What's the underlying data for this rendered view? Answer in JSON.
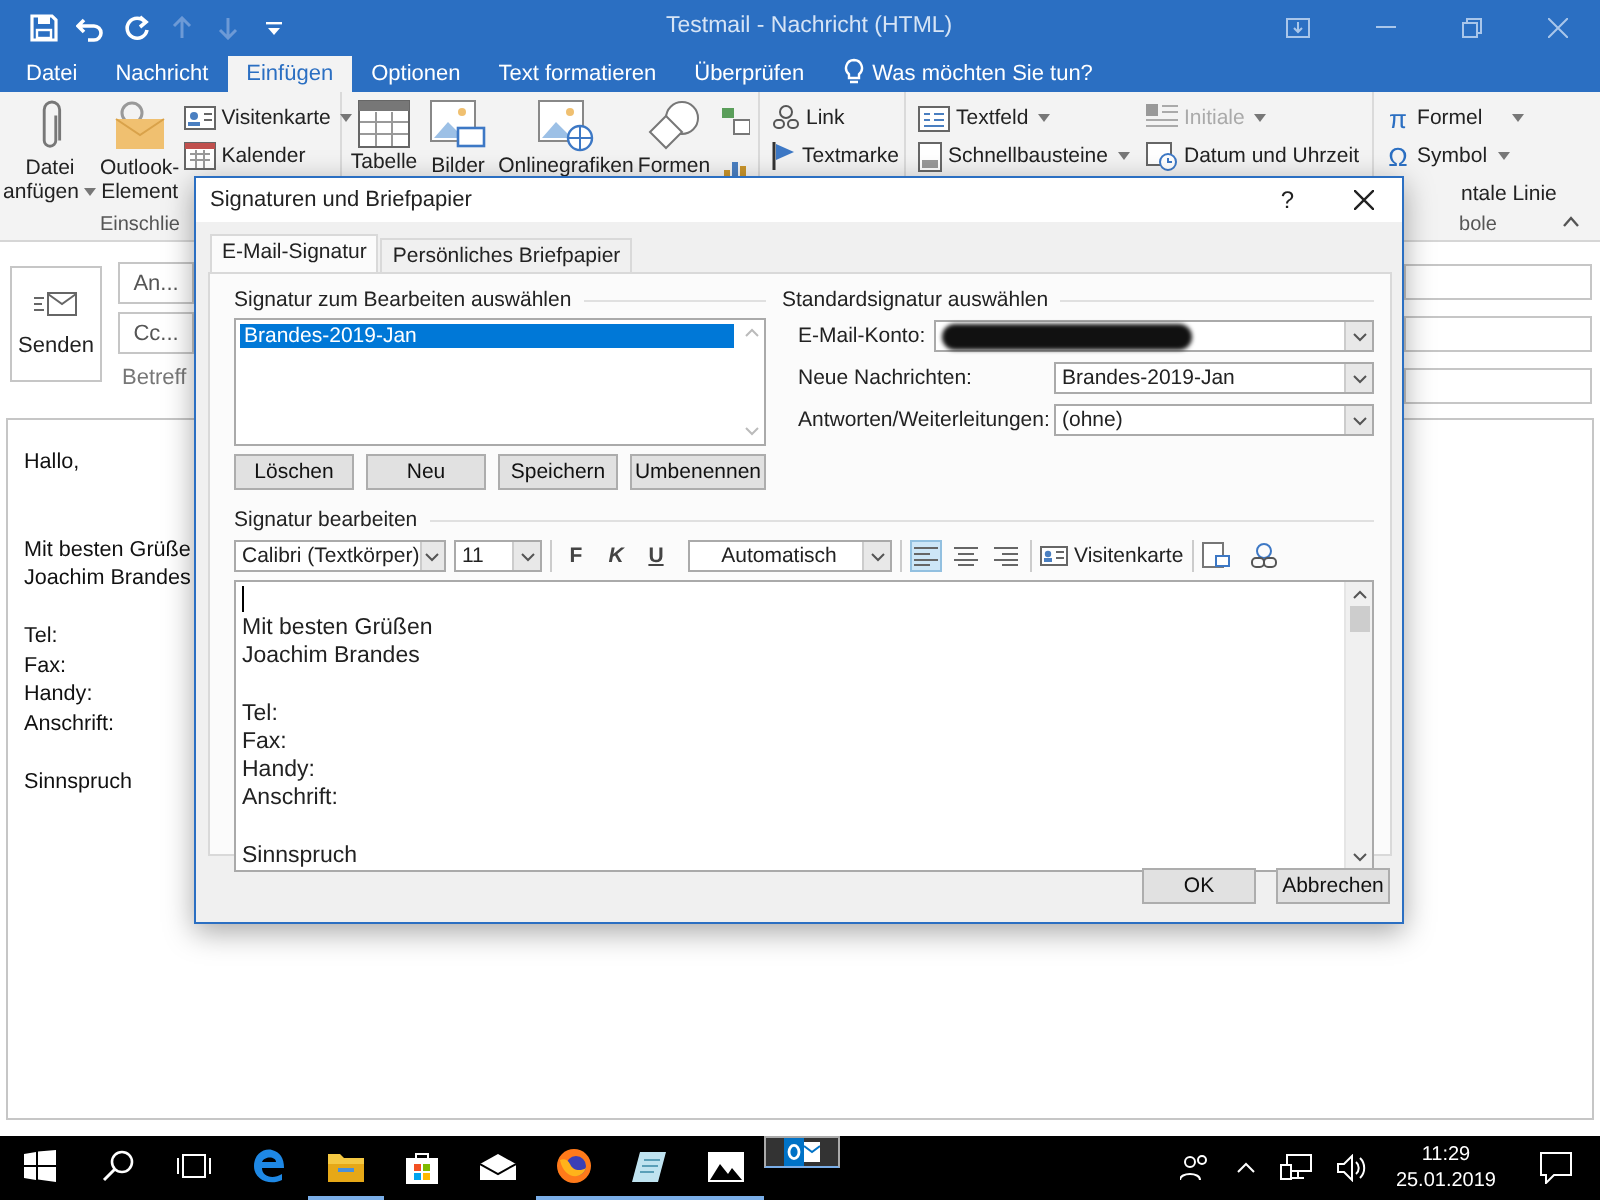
{
  "window": {
    "title": "Testmail - Nachricht (HTML)"
  },
  "quick_access": [
    {
      "kind": "save",
      "disabled": false
    },
    {
      "kind": "undo",
      "disabled": false
    },
    {
      "kind": "redo",
      "disabled": false
    },
    {
      "kind": "up",
      "disabled": true
    },
    {
      "kind": "down",
      "disabled": true
    },
    {
      "kind": "customize",
      "disabled": false
    }
  ],
  "ribbon_tabs": [
    {
      "label": "Datei",
      "selected": false
    },
    {
      "label": "Nachricht",
      "selected": false
    },
    {
      "label": "Einfügen",
      "selected": true
    },
    {
      "label": "Optionen",
      "selected": false
    },
    {
      "label": "Text formatieren",
      "selected": false
    },
    {
      "label": "Überprüfen",
      "selected": false
    }
  ],
  "tell_me": "Was möchten Sie tun?",
  "ribbon": {
    "attach_file": {
      "lines": [
        "Datei",
        "anfügen"
      ],
      "dropdown": true
    },
    "outlook_item": {
      "lines": [
        "Outlook-",
        "Element"
      ],
      "dropdown": false
    },
    "business_card": {
      "label": "Visitenkarte",
      "dropdown": true
    },
    "calendar": {
      "label": "Kalender",
      "dropdown": false
    },
    "group_include": "Einschlie",
    "table": "Tabelle",
    "pictures": "Bilder",
    "online_pictures": "Onlinegrafiken",
    "shapes": "Formen",
    "link": "Link",
    "bookmark": "Textmarke",
    "text_box": {
      "label": "Textfeld",
      "dropdown": true,
      "disabled": false
    },
    "quick_parts": {
      "label": "Schnellbausteine",
      "dropdown": true,
      "disabled": false
    },
    "drop_cap": {
      "label": "Initiale",
      "dropdown": true,
      "disabled": true
    },
    "date_time": {
      "label": "Datum und Uhrzeit",
      "dropdown": false,
      "disabled": false
    },
    "equation": {
      "glyph": "π",
      "label": "Formel",
      "dropdown": true
    },
    "symbol": {
      "glyph": "Ω",
      "label": "Symbol",
      "dropdown": true
    },
    "horizontal_line": "ntale Linie",
    "group_symbols": "bole"
  },
  "header": {
    "send_button": "Senden",
    "to_button": "An...",
    "cc_button": "Cc...",
    "subject_label": "Betreff"
  },
  "message_body": [
    [
      "Hallo,"
    ],
    [
      "Mit besten Grüße",
      "Joachim Brandes"
    ],
    [
      "Tel:",
      "Fax:",
      "Handy:",
      "Anschrift:"
    ],
    [
      "Sinnspruch"
    ]
  ],
  "dialog": {
    "title": "Signaturen und Briefpapier",
    "help_button": "?",
    "tabs": [
      {
        "label": "E-Mail-Signatur",
        "selected": true
      },
      {
        "label": "Persönliches Briefpapier",
        "selected": false
      }
    ],
    "signature_list": {
      "heading": "Signatur zum Bearbeiten auswählen",
      "items": [
        {
          "label": "Brandes-2019-Jan",
          "selected": true
        }
      ]
    },
    "list_buttons": [
      "Löschen",
      "Neu",
      "Speichern",
      "Umbenennen"
    ],
    "defaults": {
      "heading": "Standardsignatur auswählen",
      "fields": [
        {
          "label": "E-Mail-Konto:",
          "kind": "redacted"
        },
        {
          "label": "Neue Nachrichten:",
          "kind": "select",
          "value": "Brandes-2019-Jan"
        },
        {
          "label": "Antworten/Weiterleitungen:",
          "kind": "select",
          "value": "(ohne)"
        }
      ]
    },
    "editor": {
      "heading": "Signatur bearbeiten",
      "font": "Calibri (Textkörper)",
      "size": "11",
      "format_buttons": [
        "F",
        "K",
        "U"
      ],
      "font_color_choice": "Automatisch",
      "alignment": [
        {
          "kind": "left",
          "selected": true
        },
        {
          "kind": "center",
          "selected": false
        },
        {
          "kind": "right",
          "selected": false
        }
      ],
      "business_card_button": "Visitenkarte",
      "paragraphs": [
        [
          "Mit besten Grüßen",
          "Joachim Brandes"
        ],
        [
          "Tel:",
          "Fax:",
          "Handy:",
          "Anschrift:"
        ],
        [
          "Sinnspruch"
        ]
      ]
    },
    "buttons": [
      "OK",
      "Abbrechen"
    ]
  },
  "taskbar": {
    "items": [
      {
        "kind": "start",
        "running": false,
        "selected": false
      },
      {
        "kind": "search",
        "running": false,
        "selected": false
      },
      {
        "kind": "task-view",
        "running": false,
        "selected": false
      },
      {
        "kind": "edge",
        "running": false,
        "selected": false
      },
      {
        "kind": "explorer",
        "running": true,
        "selected": false
      },
      {
        "kind": "store",
        "running": false,
        "selected": false
      },
      {
        "kind": "mail",
        "running": false,
        "selected": false
      },
      {
        "kind": "firefox",
        "running": true,
        "selected": false
      },
      {
        "kind": "notes",
        "running": true,
        "selected": false
      },
      {
        "kind": "photos",
        "running": true,
        "selected": false
      },
      {
        "kind": "outlook",
        "running": true,
        "selected": true
      }
    ],
    "time": "11:29",
    "date": "25.01.2019"
  }
}
